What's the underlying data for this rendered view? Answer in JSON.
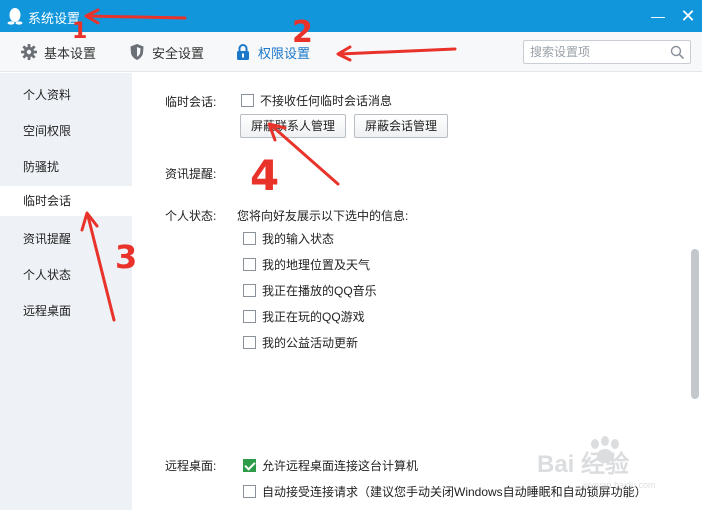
{
  "window": {
    "title": "系统设置",
    "minimize_glyph": "—",
    "close_glyph": "✕"
  },
  "toolbar": {
    "tabs": [
      {
        "label": "基本设置",
        "icon": "gear-icon"
      },
      {
        "label": "安全设置",
        "icon": "shield-icon"
      },
      {
        "label": "权限设置",
        "icon": "lock-icon"
      }
    ],
    "active_tab": "权限设置",
    "search": {
      "placeholder": "搜索设置项",
      "value": ""
    }
  },
  "sidebar": {
    "items": [
      {
        "label": "个人资料"
      },
      {
        "label": "空间权限"
      },
      {
        "label": "防骚扰"
      },
      {
        "label": "临时会话"
      },
      {
        "label": "资讯提醒"
      },
      {
        "label": "个人状态"
      },
      {
        "label": "远程桌面"
      }
    ],
    "active_item": "临时会话"
  },
  "content": {
    "temp_chat": {
      "label": "临时会话:",
      "option": {
        "label": "不接收任何临时会话消息",
        "checked": false
      },
      "buttons": [
        "屏蔽联系人管理",
        "屏蔽会话管理"
      ]
    },
    "news": {
      "label": "资讯提醒:"
    },
    "status": {
      "label": "个人状态:",
      "intro": "您将向好友展示以下选中的信息:",
      "options": [
        {
          "label": "我的输入状态",
          "checked": false
        },
        {
          "label": "我的地理位置及天气",
          "checked": false
        },
        {
          "label": "我正在播放的QQ音乐",
          "checked": false
        },
        {
          "label": "我正在玩的QQ游戏",
          "checked": false
        },
        {
          "label": "我的公益活动更新",
          "checked": false
        }
      ]
    },
    "remote": {
      "label": "远程桌面:",
      "options": [
        {
          "label": "允许远程桌面连接这台计算机",
          "checked": true
        },
        {
          "label": "自动接受连接请求（建议您手动关闭Windows自动睡眠和自动锁屏功能）",
          "checked": false
        }
      ]
    }
  },
  "annotations": {
    "numbers": [
      "1",
      "2",
      "3",
      "4"
    ],
    "color": "#e8322a"
  },
  "watermark": {
    "text": "Bai 经验",
    "sub": "jingyan.baidu.com"
  },
  "colors": {
    "titlebar": "#1296db",
    "accent": "#1c79c9",
    "check": "#2e9b48"
  }
}
